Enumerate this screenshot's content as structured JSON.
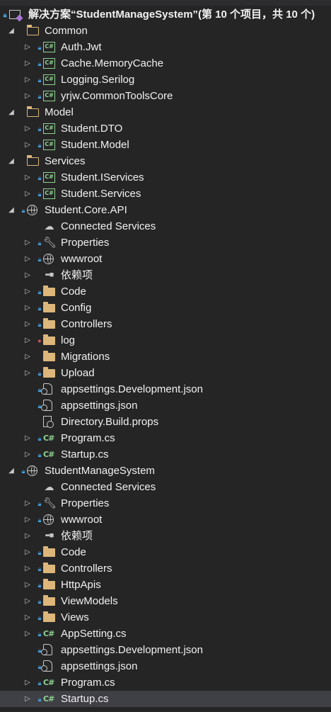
{
  "colors": {
    "background": "#252526",
    "text": "#f1f1f1",
    "selected": "#3f3f46",
    "folder": "#dcb67a",
    "csharp": "#8fd18f",
    "lock": "#4aa3df"
  },
  "solution": {
    "label": "解决方案“StudentManageSystem”(第 10 个项目，共 10 个)"
  },
  "items": [
    {
      "label": "Common",
      "depth": 1,
      "arrow": "expanded",
      "icon": "folder-open-icon",
      "lock": false
    },
    {
      "label": "Auth.Jwt",
      "depth": 2,
      "arrow": "collapsed",
      "icon": "csproj-icon",
      "lock": true
    },
    {
      "label": "Cache.MemoryCache",
      "depth": 2,
      "arrow": "collapsed",
      "icon": "csproj-icon",
      "lock": true
    },
    {
      "label": "Logging.Serilog",
      "depth": 2,
      "arrow": "collapsed",
      "icon": "csproj-icon",
      "lock": true
    },
    {
      "label": "yrjw.CommonToolsCore",
      "depth": 2,
      "arrow": "collapsed",
      "icon": "csproj-icon",
      "lock": true
    },
    {
      "label": "Model",
      "depth": 1,
      "arrow": "expanded",
      "icon": "folder-open-icon",
      "lock": false
    },
    {
      "label": "Student.DTO",
      "depth": 2,
      "arrow": "collapsed",
      "icon": "csproj-icon",
      "lock": true
    },
    {
      "label": "Student.Model",
      "depth": 2,
      "arrow": "collapsed",
      "icon": "csproj-icon",
      "lock": true
    },
    {
      "label": "Services",
      "depth": 1,
      "arrow": "expanded",
      "icon": "folder-open-icon",
      "lock": false
    },
    {
      "label": "Student.IServices",
      "depth": 2,
      "arrow": "collapsed",
      "icon": "csproj-icon",
      "lock": true
    },
    {
      "label": "Student.Services",
      "depth": 2,
      "arrow": "collapsed",
      "icon": "csproj-icon",
      "lock": true
    },
    {
      "label": "Student.Core.API",
      "depth": 1,
      "arrow": "expanded",
      "icon": "web-project-icon",
      "lock": true
    },
    {
      "label": "Connected Services",
      "depth": 2,
      "arrow": "none",
      "icon": "cloud-icon",
      "lock": false
    },
    {
      "label": "Properties",
      "depth": 2,
      "arrow": "collapsed",
      "icon": "wrench-icon",
      "lock": true
    },
    {
      "label": "wwwroot",
      "depth": 2,
      "arrow": "collapsed",
      "icon": "globe-icon",
      "lock": true
    },
    {
      "label": "依赖项",
      "depth": 2,
      "arrow": "collapsed",
      "icon": "dependencies-icon",
      "lock": false
    },
    {
      "label": "Code",
      "depth": 2,
      "arrow": "collapsed",
      "icon": "folder-icon",
      "lock": true
    },
    {
      "label": "Config",
      "depth": 2,
      "arrow": "collapsed",
      "icon": "folder-icon",
      "lock": true
    },
    {
      "label": "Controllers",
      "depth": 2,
      "arrow": "collapsed",
      "icon": "folder-icon",
      "lock": true
    },
    {
      "label": "log",
      "depth": 2,
      "arrow": "collapsed",
      "icon": "folder-icon",
      "lock": "red"
    },
    {
      "label": "Migrations",
      "depth": 2,
      "arrow": "collapsed",
      "icon": "folder-icon",
      "lock": false
    },
    {
      "label": "Upload",
      "depth": 2,
      "arrow": "collapsed",
      "icon": "folder-icon",
      "lock": true
    },
    {
      "label": "appsettings.Development.json",
      "depth": 2,
      "arrow": "none",
      "icon": "json-file-icon",
      "lock": true
    },
    {
      "label": "appsettings.json",
      "depth": 2,
      "arrow": "none",
      "icon": "json-file-icon",
      "lock": true
    },
    {
      "label": "Directory.Build.props",
      "depth": 2,
      "arrow": "none",
      "icon": "props-file-icon",
      "lock": false
    },
    {
      "label": "Program.cs",
      "depth": 2,
      "arrow": "collapsed",
      "icon": "csharp-file-icon",
      "lock": true
    },
    {
      "label": "Startup.cs",
      "depth": 2,
      "arrow": "collapsed",
      "icon": "csharp-file-icon",
      "lock": true
    },
    {
      "label": "StudentManageSystem",
      "depth": 1,
      "arrow": "expanded",
      "icon": "web-project-icon",
      "lock": true
    },
    {
      "label": "Connected Services",
      "depth": 2,
      "arrow": "none",
      "icon": "cloud-icon",
      "lock": false
    },
    {
      "label": "Properties",
      "depth": 2,
      "arrow": "collapsed",
      "icon": "wrench-icon",
      "lock": true
    },
    {
      "label": "wwwroot",
      "depth": 2,
      "arrow": "collapsed",
      "icon": "globe-icon",
      "lock": true
    },
    {
      "label": "依赖项",
      "depth": 2,
      "arrow": "collapsed",
      "icon": "dependencies-icon",
      "lock": false
    },
    {
      "label": "Code",
      "depth": 2,
      "arrow": "collapsed",
      "icon": "folder-icon",
      "lock": true
    },
    {
      "label": "Controllers",
      "depth": 2,
      "arrow": "collapsed",
      "icon": "folder-icon",
      "lock": true
    },
    {
      "label": "HttpApis",
      "depth": 2,
      "arrow": "collapsed",
      "icon": "folder-icon",
      "lock": true
    },
    {
      "label": "ViewModels",
      "depth": 2,
      "arrow": "collapsed",
      "icon": "folder-icon",
      "lock": true
    },
    {
      "label": "Views",
      "depth": 2,
      "arrow": "collapsed",
      "icon": "folder-icon",
      "lock": true
    },
    {
      "label": "AppSetting.cs",
      "depth": 2,
      "arrow": "collapsed",
      "icon": "csharp-file-icon",
      "lock": true
    },
    {
      "label": "appsettings.Development.json",
      "depth": 2,
      "arrow": "none",
      "icon": "json-file-icon",
      "lock": true
    },
    {
      "label": "appsettings.json",
      "depth": 2,
      "arrow": "none",
      "icon": "json-file-icon",
      "lock": true
    },
    {
      "label": "Program.cs",
      "depth": 2,
      "arrow": "collapsed",
      "icon": "csharp-file-icon",
      "lock": true
    },
    {
      "label": "Startup.cs",
      "depth": 2,
      "arrow": "collapsed",
      "icon": "csharp-file-icon",
      "lock": true,
      "selected": true
    }
  ]
}
